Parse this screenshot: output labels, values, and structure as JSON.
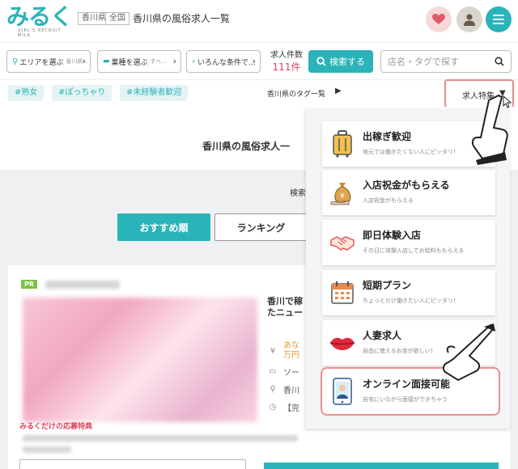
{
  "header": {
    "logo_text": "みるく",
    "logo_subtitle": "GIRL'S RECRUIT MILK",
    "pref_tag": "香川県",
    "scope_tag": "全国",
    "page_title": "香川県の風俗求人一覧"
  },
  "search": {
    "area_label": "エリアを選ぶ",
    "area_placeholder": "香川県...",
    "industry_label": "業種を選ぶ",
    "industry_placeholder": "すべ...",
    "condition_label": "いろんな条件で...",
    "count_label": "求人件数",
    "count_value": "111件",
    "search_button": "検索する",
    "name_placeholder": "店名・タグで探す"
  },
  "tags": {
    "items": [
      "#熟女",
      "#ぽっちゃり",
      "#未経験者歓迎"
    ],
    "tag_list_link": "香川県のタグ一覧",
    "feature_tab": "求人特集"
  },
  "main": {
    "heading": "香川県の風俗求人一",
    "search_note": "検索",
    "sort_recommended": "おすすめ順",
    "sort_ranking": "ランキング"
  },
  "card": {
    "pr_badge": "PR",
    "title": "香川で稼\nたニュー",
    "salary_text": "あな\n万円",
    "type_text": "ソー",
    "location_text": "香川",
    "hours_text": "【完",
    "benefit_label": "みるくだけの応募特典"
  },
  "feature_menu": [
    {
      "title": "出稼ぎ歓迎",
      "subtitle": "地元では働きたくない人にピッタリ！",
      "icon": "suitcase-icon"
    },
    {
      "title": "入店祝金がもらえる",
      "subtitle": "入店祝金がもらえる",
      "icon": "money-bag-icon"
    },
    {
      "title": "即日体験入店",
      "subtitle": "その日に体験入店してお給料ももらえる",
      "icon": "handshake-icon"
    },
    {
      "title": "短期プラン",
      "subtitle": "ちょっとだけ働きたい人にピッタリ！",
      "icon": "calendar-icon"
    },
    {
      "title": "人妻求人",
      "subtitle": "自由に使えるお金が欲しい！",
      "icon": "lips-icon"
    },
    {
      "title": "オンライン面接可能",
      "subtitle": "自宅にいながら面接ができちゃう",
      "icon": "online-interview-icon"
    }
  ],
  "colors": {
    "accent": "#2ab3b8",
    "highlight": "#e98a8a",
    "count": "#e0445c",
    "pr": "#7cc243"
  }
}
